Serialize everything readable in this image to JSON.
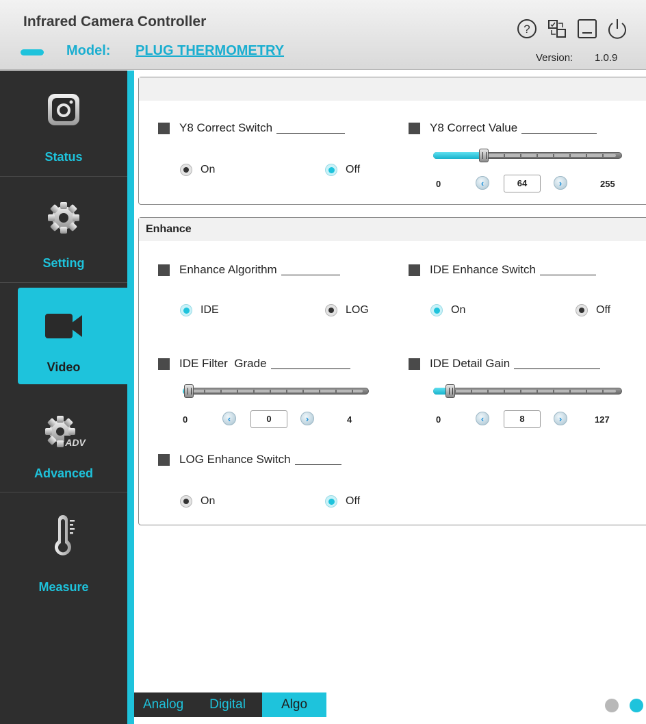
{
  "header": {
    "title": "Infrared Camera Controller",
    "model_label": "Model:",
    "model_value": "PLUG THERMOMETRY",
    "version_label": "Version:",
    "version_value": "1.0.9",
    "icons": [
      "help-icon",
      "window-switch-icon",
      "minimize-icon",
      "power-icon"
    ]
  },
  "sidebar": {
    "items": [
      {
        "label": "Status",
        "icon": "camera-icon",
        "active": false
      },
      {
        "label": "Setting",
        "icon": "gear-icon",
        "active": false
      },
      {
        "label": "Video",
        "icon": "video-camera-icon",
        "active": true
      },
      {
        "label": "Advanced",
        "icon": "advanced-gear-icon",
        "active": false
      },
      {
        "label": "Measure",
        "icon": "thermometer-icon",
        "active": false
      }
    ]
  },
  "y8_group": {
    "header": "",
    "y8_correct_switch": {
      "label": "Y8 Correct Switch",
      "options": [
        {
          "label": "On",
          "selected": false
        },
        {
          "label": "Off",
          "selected": true
        }
      ]
    },
    "y8_correct_value": {
      "label": "Y8 Correct Value",
      "min": "0",
      "max": "255",
      "value": "64",
      "fraction": 0.251
    }
  },
  "enhance_group": {
    "header": "Enhance",
    "enhance_algorithm": {
      "label": "Enhance Algorithm",
      "options": [
        {
          "label": "IDE",
          "selected": true
        },
        {
          "label": "LOG",
          "selected": false
        }
      ]
    },
    "ide_enhance_switch": {
      "label": "IDE Enhance Switch",
      "options": [
        {
          "label": "On",
          "selected": true
        },
        {
          "label": "Off",
          "selected": false
        }
      ]
    },
    "ide_filter_grade": {
      "label": "IDE Filter  Grade",
      "min": "0",
      "max": "4",
      "value": "0",
      "fraction": 0.0
    },
    "ide_detail_gain": {
      "label": "IDE Detail Gain",
      "min": "0",
      "max": "127",
      "value": "8",
      "fraction": 0.063
    },
    "log_enhance_switch": {
      "label": "LOG Enhance Switch",
      "options": [
        {
          "label": "On",
          "selected": false
        },
        {
          "label": "Off",
          "selected": true
        }
      ]
    }
  },
  "tabs": [
    {
      "label": "Analog",
      "active": false
    },
    {
      "label": "Digital",
      "active": false
    },
    {
      "label": "Algo",
      "active": true
    }
  ],
  "pagination": {
    "total": 2,
    "current": 2
  },
  "colors": {
    "accent": "#1ec3dc",
    "sidebar_bg": "#2e2e2e",
    "header_bg": "#e5e5e5"
  }
}
